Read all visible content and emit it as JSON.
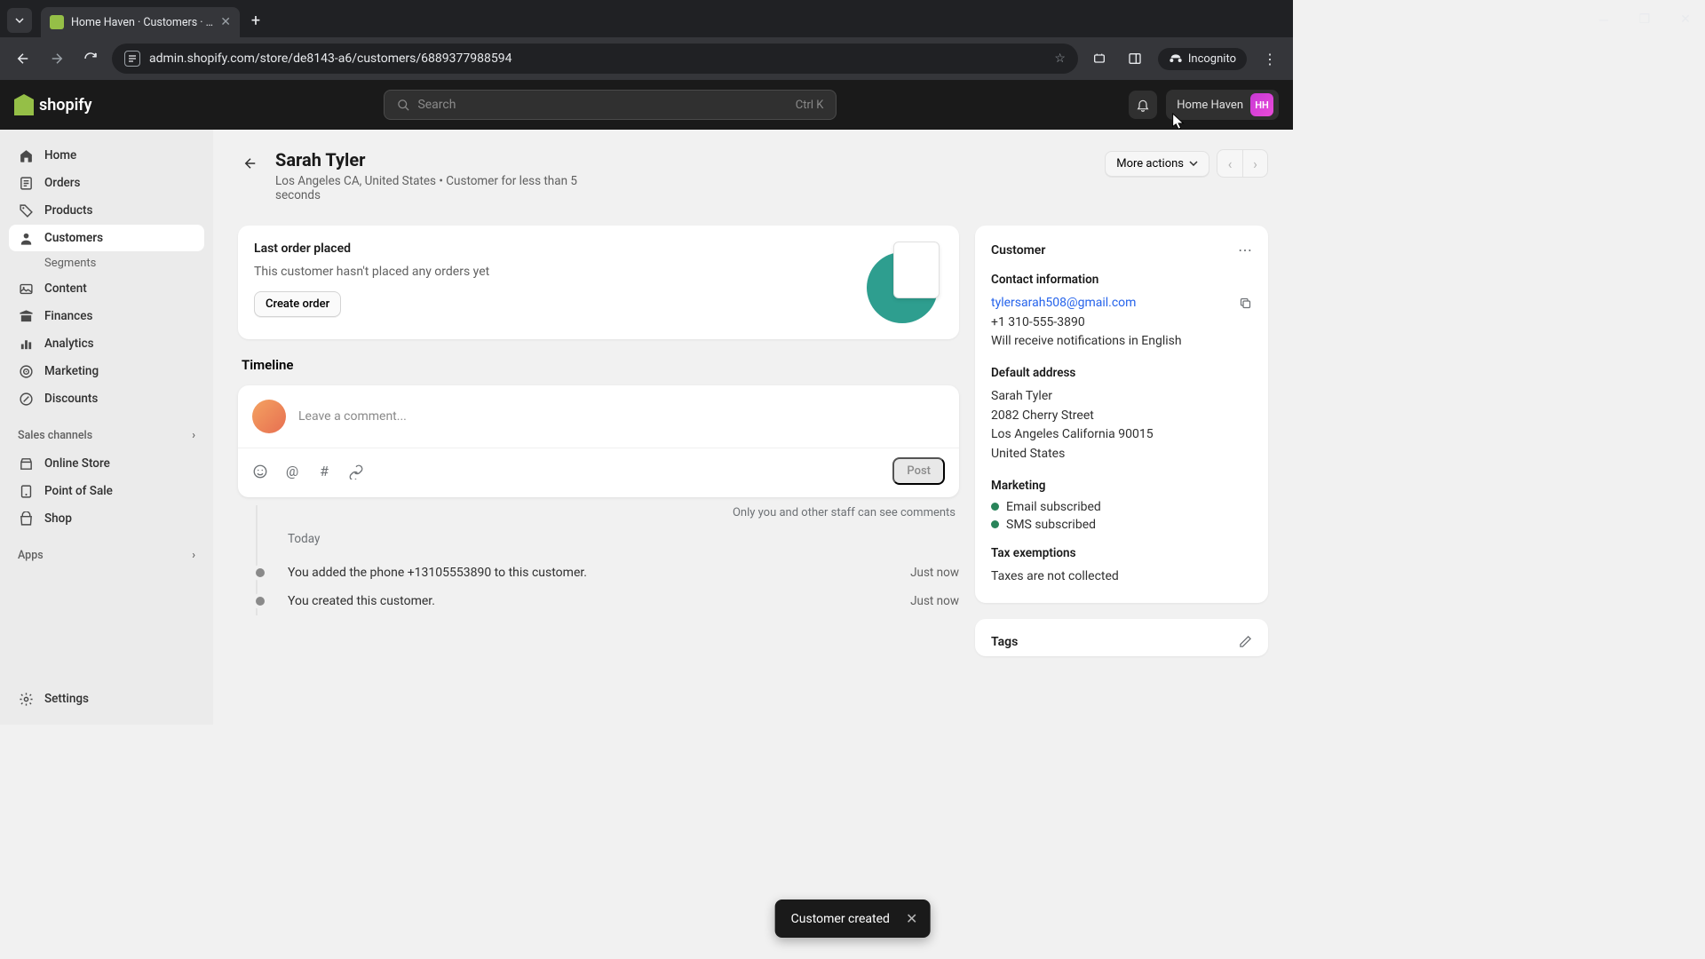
{
  "browser": {
    "tab_title": "Home Haven · Customers · Sar",
    "url": "admin.shopify.com/store/de8143-a6/customers/6889377988594",
    "incognito_label": "Incognito"
  },
  "header": {
    "logo_text": "shopify",
    "search_placeholder": "Search",
    "search_shortcut": "Ctrl K",
    "store_name": "Home Haven",
    "store_initials": "HH"
  },
  "sidebar": {
    "items": [
      {
        "label": "Home",
        "icon": "home"
      },
      {
        "label": "Orders",
        "icon": "orders"
      },
      {
        "label": "Products",
        "icon": "products"
      },
      {
        "label": "Customers",
        "icon": "customers",
        "active": true
      },
      {
        "label": "Content",
        "icon": "content"
      },
      {
        "label": "Finances",
        "icon": "finances"
      },
      {
        "label": "Analytics",
        "icon": "analytics"
      },
      {
        "label": "Marketing",
        "icon": "marketing"
      },
      {
        "label": "Discounts",
        "icon": "discounts"
      }
    ],
    "sub_segments": "Segments",
    "sales_channels_label": "Sales channels",
    "channels": [
      {
        "label": "Online Store"
      },
      {
        "label": "Point of Sale"
      },
      {
        "label": "Shop"
      }
    ],
    "apps_label": "Apps",
    "settings_label": "Settings"
  },
  "page": {
    "title": "Sarah Tyler",
    "subtitle": "Los Angeles CA, United States • Customer for less than 5 seconds",
    "more_actions": "More actions"
  },
  "last_order": {
    "title": "Last order placed",
    "desc": "This customer hasn't placed any orders yet",
    "button": "Create order"
  },
  "timeline": {
    "title": "Timeline",
    "comment_placeholder": "Leave a comment...",
    "post_label": "Post",
    "note": "Only you and other staff can see comments",
    "today_label": "Today",
    "entries": [
      {
        "text": "You added the phone +13105553890 to this customer.",
        "time": "Just now"
      },
      {
        "text": "You created this customer.",
        "time": "Just now"
      }
    ]
  },
  "customer_card": {
    "title": "Customer",
    "contact_label": "Contact information",
    "email": "tylersarah508@gmail.com",
    "phone": "+1 310-555-3890",
    "notif": "Will receive notifications in English",
    "address_label": "Default address",
    "addr_name": "Sarah Tyler",
    "addr_street": "2082 Cherry Street",
    "addr_city": "Los Angeles California 90015",
    "addr_country": "United States",
    "marketing_label": "Marketing",
    "marketing_email": "Email subscribed",
    "marketing_sms": "SMS subscribed",
    "tax_label": "Tax exemptions",
    "tax_value": "Taxes are not collected"
  },
  "tags_card": {
    "title": "Tags"
  },
  "toast": {
    "message": "Customer created"
  }
}
